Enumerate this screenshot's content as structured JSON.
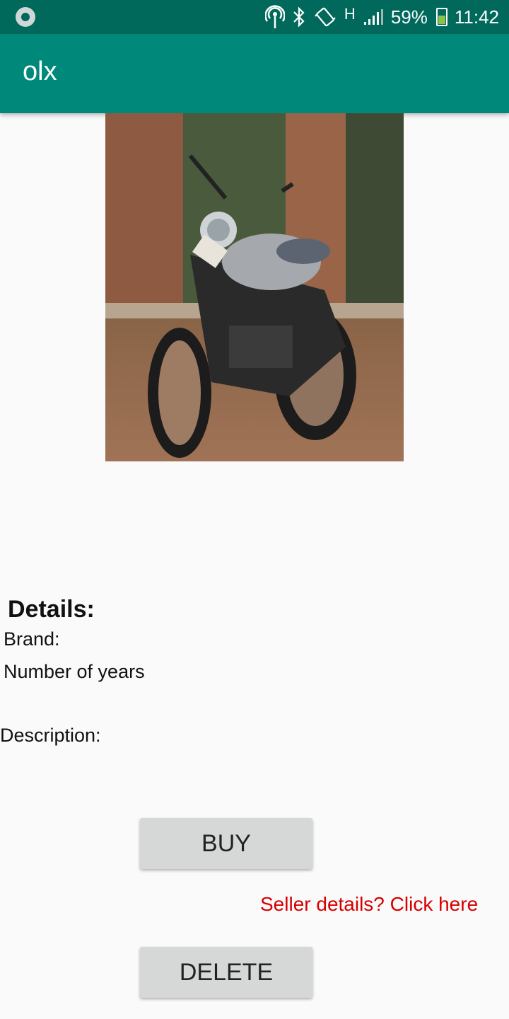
{
  "status_bar": {
    "battery": "59%",
    "time": "11:42",
    "network": "H",
    "icons": [
      "app-notification-icon",
      "hotspot-icon",
      "bluetooth-icon",
      "vibrate-icon",
      "signal-icon",
      "battery-icon"
    ]
  },
  "app_bar": {
    "title": "olx"
  },
  "product": {
    "image_subject": "motorcycle"
  },
  "details": {
    "heading": "Details:",
    "brand_label": "Brand:",
    "years_label": "Number of years",
    "description_label": "Description:"
  },
  "actions": {
    "buy_label": "BUY",
    "seller_link": "Seller details? Click here",
    "delete_label": "DELETE"
  },
  "colors": {
    "status_bar": "#00695c",
    "app_bar": "#00897b",
    "link": "#d50000",
    "button": "#d6d7d7"
  }
}
